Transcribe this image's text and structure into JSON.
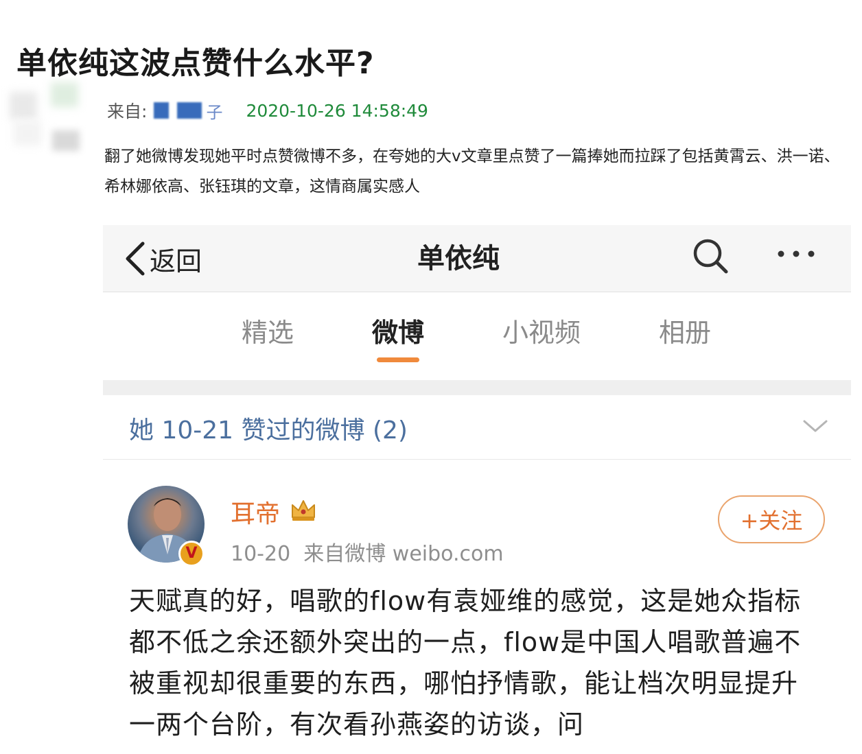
{
  "article": {
    "title": "单依纯这波点赞什么水平?",
    "from_label": "来自:",
    "from_user_tail": "子",
    "timestamp": "2020-10-26 14:58:49",
    "body": "翻了她微博发现她平时点赞微博不多，在夸她的大v文章里点赞了一篇捧她而拉踩了包括黄霄云、洪一诺、希林娜依高、张钰琪的文章，这情商属实感人"
  },
  "screenshot": {
    "nav": {
      "back_label": "返回",
      "title": "单依纯",
      "search_icon": "search-icon",
      "more_icon": "more-icon"
    },
    "tabs": [
      {
        "label": "精选"
      },
      {
        "label": "微博"
      },
      {
        "label": "小视频"
      },
      {
        "label": "相册"
      }
    ],
    "active_tab": "微博",
    "liked_header": "她 10-21 赞过的微博 (2)",
    "post": {
      "author": "耳帝",
      "verified_badge": "V",
      "meta": "10-20  来自微博 weibo.com",
      "follow_label": "+关注",
      "text": "天赋真的好，唱歌的flow有袁娅维的感觉，这是她众指标都不低之余还额外突出的一点，flow是中国人唱歌普遍不被重视却很重要的东西，哪怕抒情歌，能让档次明显提升一两个台阶，有次看孙燕姿的访谈，问"
    }
  },
  "colors": {
    "timestamp": "#1f8a3a",
    "accent_orange": "#e2702f",
    "link_blue": "#4b6f9e",
    "tab_underline": "#f08a3c"
  }
}
